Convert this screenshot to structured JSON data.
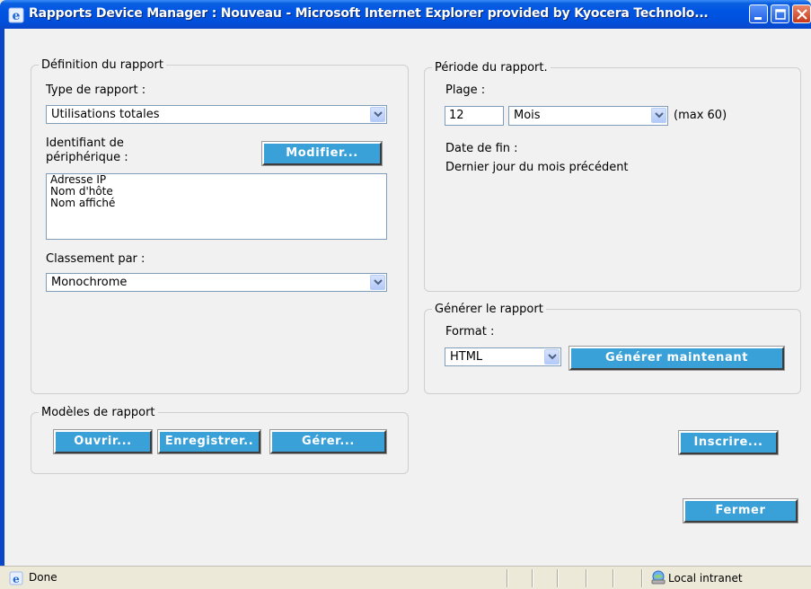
{
  "window": {
    "title": "Rapports Device Manager : Nouveau - Microsoft Internet Explorer provided by Kyocera Technolo..."
  },
  "definition": {
    "legend": "Définition du rapport",
    "type_label": "Type de rapport :",
    "type_value": "Utilisations totales",
    "device_id_label_line1": "Identifiant de",
    "device_id_label_line2": "périphérique :",
    "modify_button": "Modifier...",
    "device_ids": [
      "Adresse IP",
      "Nom d'hôte",
      "Nom affiché"
    ],
    "sort_label": "Classement par :",
    "sort_value": "Monochrome"
  },
  "period": {
    "legend": "Période du rapport.",
    "range_label": "Plage :",
    "range_value": "12",
    "unit_value": "Mois",
    "max_note": "(max 60)",
    "end_date_label": "Date de fin :",
    "end_date_value": "Dernier jour du mois précédent"
  },
  "generate": {
    "legend": "Générer le rapport",
    "format_label": "Format :",
    "format_value": "HTML",
    "generate_button": "Générer maintenant"
  },
  "templates": {
    "legend": "Modèles de rapport",
    "open_button": "Ouvrir...",
    "save_button": "Enregistrer..",
    "manage_button": "Gérer..."
  },
  "register_button": "Inscrire...",
  "close_button": "Fermer",
  "statusbar": {
    "status": "Done",
    "zone": "Local intranet"
  },
  "colors": {
    "button_blue": "#3aa0d8",
    "titlebar_blue": "#0054e3",
    "content_bg": "#f1f1f1"
  }
}
